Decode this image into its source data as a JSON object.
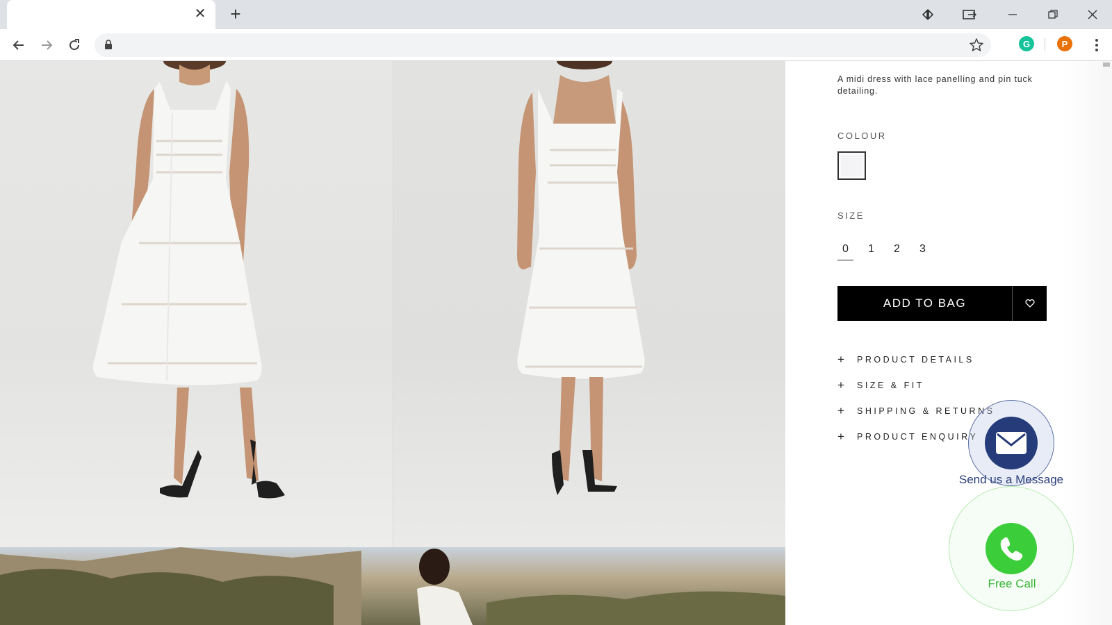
{
  "browser": {
    "tab_title": "",
    "tab_close_glyph": "✕",
    "new_tab_glyph": "+",
    "address": "",
    "profile_initial": "P",
    "extension_initial": "G",
    "colors": {
      "profile": "#e8710a",
      "extension": "#15c39a"
    }
  },
  "product": {
    "description": "A midi dress with lace panelling and pin tuck detailing.",
    "colour_label": "COLOUR",
    "size_label": "SIZE",
    "sizes": [
      "0",
      "1",
      "2",
      "3"
    ],
    "selected_size": "0",
    "add_to_bag": "ADD TO BAG",
    "accordion": [
      {
        "icon": "+",
        "label": "PRODUCT DETAILS"
      },
      {
        "icon": "+",
        "label": "SIZE & FIT"
      },
      {
        "icon": "+",
        "label": "SHIPPING & RETURNS"
      },
      {
        "icon": "+",
        "label": "PRODUCT ENQUIRY"
      }
    ]
  },
  "widgets": {
    "message_label": "Send us a Message",
    "call_label": "Free Call",
    "colors": {
      "message": "#263c7a",
      "call": "#3ccd3a"
    }
  }
}
